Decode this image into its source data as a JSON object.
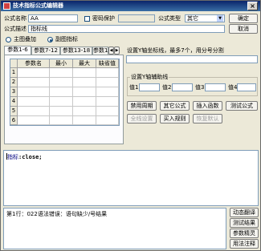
{
  "window": {
    "title": "技术指标公式编辑器",
    "close_glyph": "×"
  },
  "form": {
    "name_label": "公式名称",
    "name_value": "AA",
    "password_label": "密码保护",
    "password_value": "",
    "type_label": "公式类型",
    "type_value": "其它",
    "desc_label": "公式描述",
    "desc_value": "指标线",
    "ok_label": "确定",
    "cancel_label": "取消"
  },
  "overlay": {
    "main_label": "主图叠加",
    "sub_label": "副图指标",
    "selected": "sub"
  },
  "param_tabs": [
    "参数1-6",
    "参数7-12",
    "参数13-18",
    "参数1"
  ],
  "tab_scroll": {
    "left": "◀",
    "right": "▶"
  },
  "param_table": {
    "headers": [
      "参数名",
      "最小",
      "最大",
      "缺省值"
    ],
    "rows": [
      "1",
      "2",
      "3",
      "4",
      "5",
      "6"
    ]
  },
  "hint_text": "设置Y轴坐标线，最多7个，用分号分割",
  "aux_group": {
    "title": "设置Y轴辅助线",
    "labels": [
      "值1",
      "值2",
      "值3",
      "值4"
    ]
  },
  "actions": {
    "row1": [
      "禁用周期",
      "其它公式",
      "插入函数",
      "测试公式"
    ],
    "row2": [
      "全线设置",
      "买入规则",
      "恢复默认"
    ]
  },
  "editor": {
    "prefix": "指标",
    "code": ":close;"
  },
  "output_text": "第1行：022语法错误：语句缺少/号结果",
  "side_buttons": [
    "动态翻译",
    "测试结果",
    "参数精灵",
    "用法注释"
  ]
}
